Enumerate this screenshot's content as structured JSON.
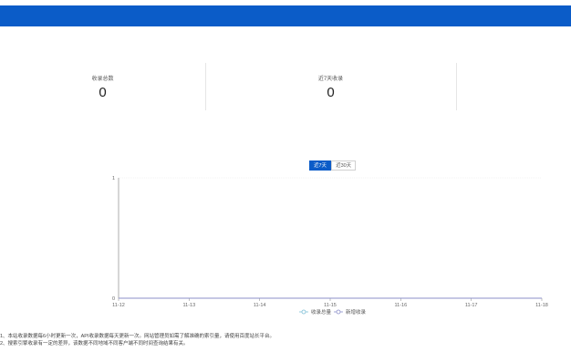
{
  "stats": [
    {
      "label": "收录总数",
      "value": "0"
    },
    {
      "label": "近7天收录",
      "value": "0"
    },
    {
      "label": "",
      "value": ""
    }
  ],
  "tabs": [
    {
      "label": "近7天",
      "active": true
    },
    {
      "label": "近30天",
      "active": false
    }
  ],
  "legend": [
    {
      "label": "收录总量",
      "color": "#7dbfd6"
    },
    {
      "label": "新增收录",
      "color": "#8b8fc9"
    }
  ],
  "notes": [
    "1、本站收录数据每6小时更新一次，API收录数据每天更新一次。网站管理员如需了解准确的索引量，请使用百度站长平台。",
    "2、搜索引擎收录有一定的差异，该数据不同地域不同客户端不同时间查询结果有关。"
  ],
  "chart_data": {
    "type": "line",
    "categories": [
      "11-12",
      "11-13",
      "11-14",
      "11-15",
      "11-16",
      "11-17",
      "11-18"
    ],
    "series": [
      {
        "name": "收录总量",
        "values": [
          0,
          0,
          0,
          0,
          0,
          0,
          0
        ]
      },
      {
        "name": "新增收录",
        "values": [
          0,
          0,
          0,
          0,
          0,
          0,
          0
        ]
      }
    ],
    "ylim": [
      0,
      1
    ],
    "yticks": [
      "0",
      "1"
    ],
    "grid": true,
    "legend_position": "bottom"
  }
}
